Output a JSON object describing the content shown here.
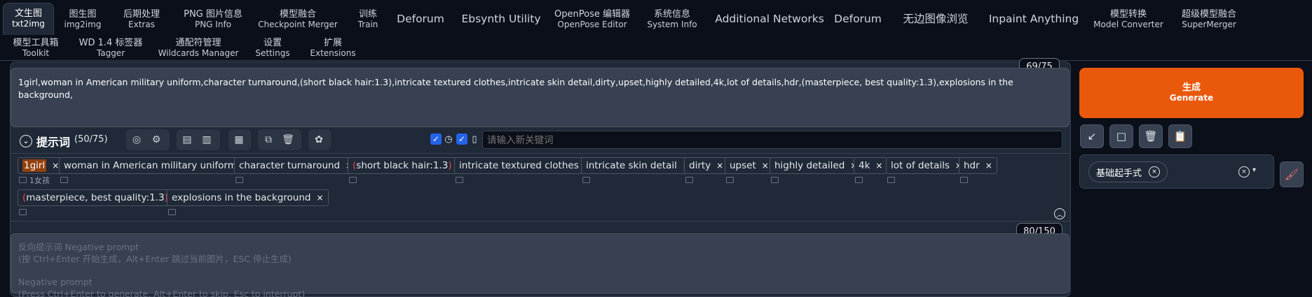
{
  "tabs": [
    {
      "label": "文生图",
      "sub": "txt2img",
      "active": true
    },
    {
      "label": "图生图",
      "sub": "img2img"
    },
    {
      "label": "后期处理",
      "sub": "Extras"
    },
    {
      "label": "PNG 图片信息",
      "sub": "PNG Info"
    },
    {
      "label": "模型融合",
      "sub": "Checkpoint Merger"
    },
    {
      "label": "训练",
      "sub": "Train"
    },
    {
      "label": "Deforum"
    },
    {
      "label": "Ebsynth Utility"
    },
    {
      "label": "OpenPose 编辑器",
      "sub": "OpenPose Editor"
    },
    {
      "label": "系统信息",
      "sub": "System Info"
    },
    {
      "label": "Additional Networks"
    },
    {
      "label": "Deforum"
    },
    {
      "label": "无边图像浏览"
    },
    {
      "label": "Inpaint Anything"
    },
    {
      "label": "模型转换",
      "sub": "Model Converter"
    },
    {
      "label": "超级模型融合",
      "sub": "SuperMerger"
    },
    {
      "label": "模型工具箱",
      "sub": "Toolkit"
    },
    {
      "label": "WD 1.4 标签器",
      "sub": "Tagger"
    },
    {
      "label": "通配符管理",
      "sub": "Wildcards Manager"
    },
    {
      "label": "设置",
      "sub": "Settings"
    },
    {
      "label": "扩展",
      "sub": "Extensions"
    }
  ],
  "prompt": {
    "counter": "69/75",
    "text": "1girl,woman in American military uniform,character turnaround,(short black hair:1.3),intricate textured clothes,intricate skin detail,dirty,upset,highly detailed,4k,lot of details,hdr,(masterpiece, best quality:1.3),explosions in the background,"
  },
  "tag_toolbar": {
    "title": "提示词",
    "count": "(50/75)",
    "keyword_placeholder": "请输入新关键词"
  },
  "tags": [
    {
      "text": "1girl",
      "translation": "1女孩"
    },
    {
      "text": "woman in American military uniform"
    },
    {
      "text": "character turnaround"
    },
    {
      "text": "short black hair:1.3",
      "paren": true
    },
    {
      "text": "intricate textured clothes"
    },
    {
      "text": "intricate skin detail"
    },
    {
      "text": "dirty"
    },
    {
      "text": "upset"
    },
    {
      "text": "highly detailed"
    },
    {
      "text": "4k"
    },
    {
      "text": "lot of details"
    },
    {
      "text": "hdr"
    },
    {
      "text": "masterpiece, best quality:1.3",
      "paren": true
    },
    {
      "text": "explosions in the background"
    }
  ],
  "negative": {
    "counter": "80/150",
    "placeholder_line1": "反向提示词 Negative prompt",
    "placeholder_line2": "(按 Ctrl+Enter 开始生成，Alt+Enter 跳过当前图片，ESC 停止生成)",
    "placeholder_line3": "Negative prompt",
    "placeholder_line4": "(Press Ctrl+Enter to generate, Alt+Enter to skip, Esc to interrupt)"
  },
  "generate": {
    "label": "生成",
    "sub": "Generate",
    "color": "#ea580c"
  },
  "styles": {
    "selected": "基础起手式"
  },
  "icons": {
    "close": "×",
    "check": "✓",
    "chevron_down": "⌄",
    "chevron_up": "︿",
    "dropdown": "▾"
  }
}
